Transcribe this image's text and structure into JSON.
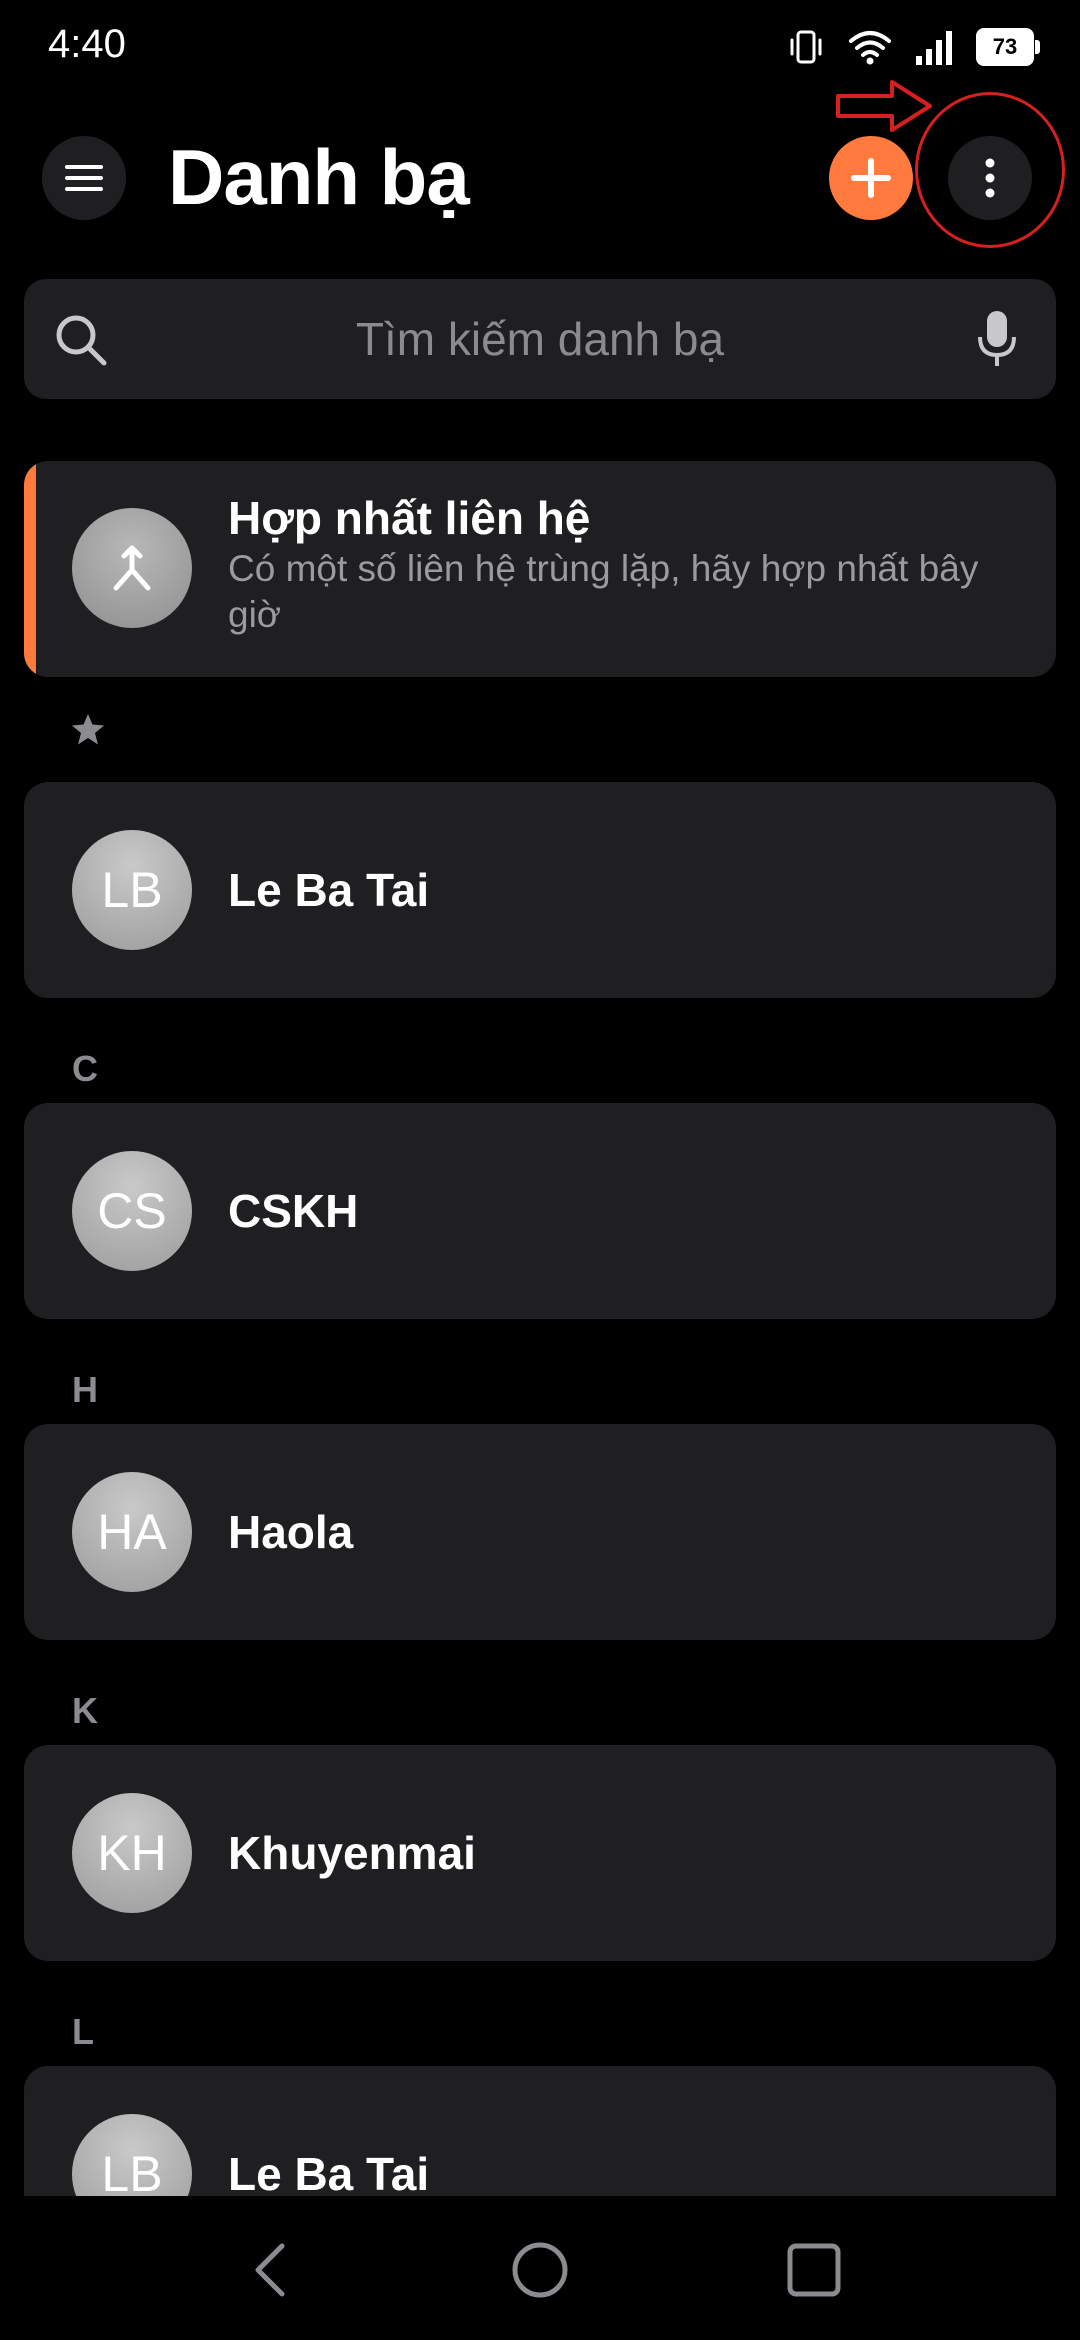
{
  "status_bar": {
    "time": "4:40",
    "battery": "73",
    "icons": [
      "vibrate-icon",
      "wifi-icon",
      "signal-icon",
      "battery-icon"
    ]
  },
  "header": {
    "title": "Danh bạ",
    "menu_icon": "hamburger-icon",
    "add_icon": "plus-icon",
    "more_icon": "more-vertical-icon"
  },
  "search": {
    "placeholder": "Tìm kiếm danh bạ",
    "icon": "search-icon",
    "mic_icon": "mic-icon"
  },
  "merge_card": {
    "title": "Hợp nhất liên hệ",
    "subtitle": "Có một số liên hệ trùng lặp, hãy hợp nhất bây giờ",
    "icon": "merge-icon",
    "accent_color": "#ff7a3c"
  },
  "sections": {
    "favorites_icon": "star-icon",
    "c": "C",
    "h": "H",
    "k": "K",
    "l": "L"
  },
  "contacts": [
    {
      "initials": "LB",
      "name": "Le Ba Tai"
    },
    {
      "initials": "CS",
      "name": "CSKH"
    },
    {
      "initials": "HA",
      "name": "Haola"
    },
    {
      "initials": "KH",
      "name": "Khuyenmai"
    },
    {
      "initials": "LB",
      "name": "Le Ba Tai"
    }
  ],
  "nav": {
    "back_icon": "back-icon",
    "home_icon": "home-icon",
    "recents_icon": "recents-icon"
  },
  "colors": {
    "background": "#000000",
    "card": "#1f1f22",
    "accent": "#ff7a3c",
    "annotation": "#d62020"
  }
}
